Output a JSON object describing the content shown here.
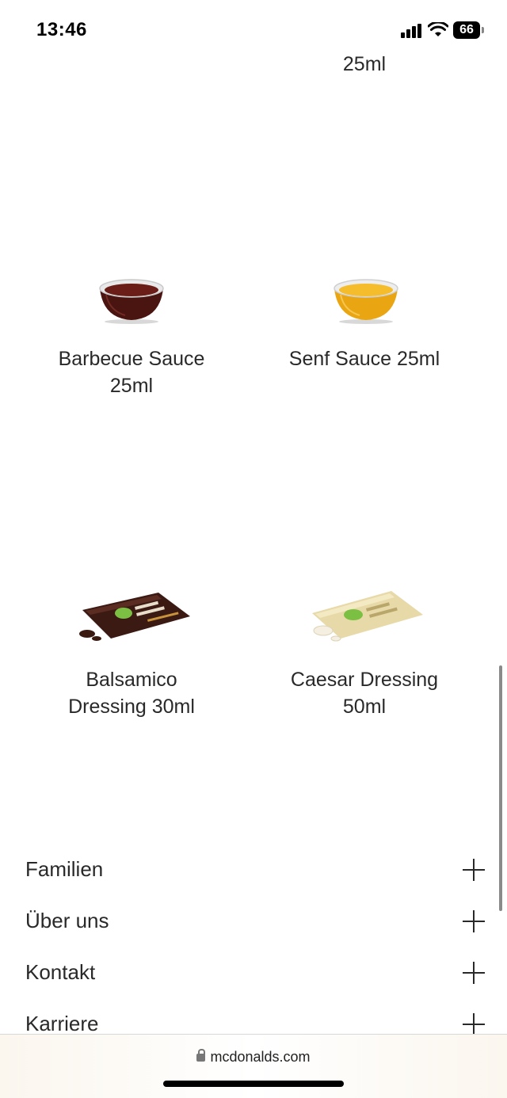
{
  "status_bar": {
    "time": "13:46",
    "battery": "66"
  },
  "top_partial_text": "25ml",
  "products": [
    {
      "name_line1": "Barbecue Sauce",
      "name_line2": "25ml"
    },
    {
      "name_line1": "Senf Sauce 25ml",
      "name_line2": ""
    },
    {
      "name_line1": "Balsamico",
      "name_line2": "Dressing 30ml"
    },
    {
      "name_line1": "Caesar Dressing",
      "name_line2": "50ml"
    }
  ],
  "footer": {
    "items": [
      {
        "label": "Familien"
      },
      {
        "label": "Über uns"
      },
      {
        "label": "Kontakt"
      },
      {
        "label": "Karriere"
      }
    ]
  },
  "browser": {
    "url": "mcdonalds.com"
  },
  "colors": {
    "text": "#292929",
    "bbq": "#5a1a14",
    "mustard": "#f0b21d"
  }
}
